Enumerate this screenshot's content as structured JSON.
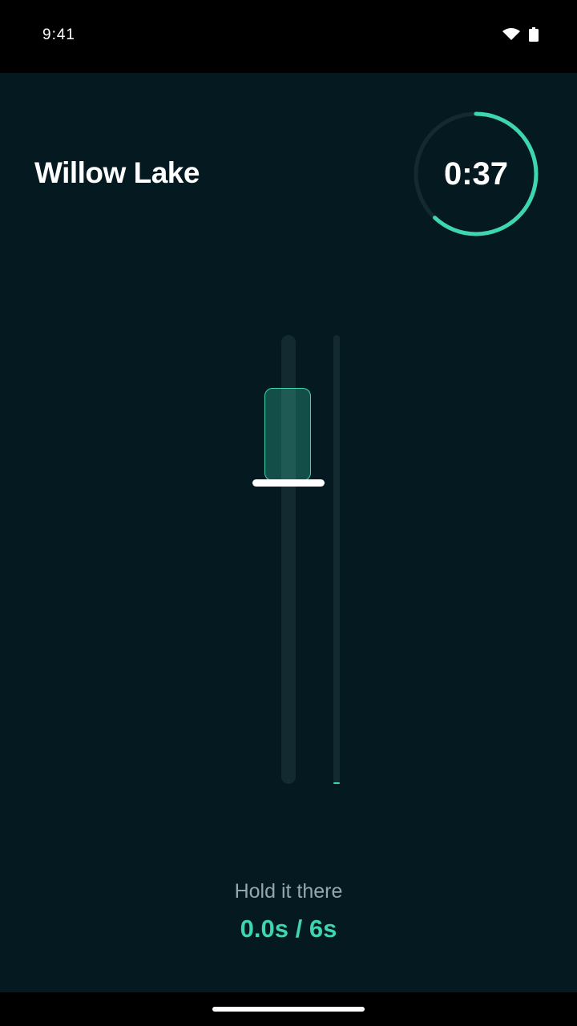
{
  "status_bar": {
    "time": "9:41",
    "icons": [
      "wifi-icon",
      "battery-icon"
    ]
  },
  "header": {
    "title": "Willow Lake",
    "timer_text": "0:37",
    "timer_progress": 0.62
  },
  "slider": {
    "hold_progress": 0.0
  },
  "footer": {
    "hint": "Hold it there",
    "hold_counter": "0.0s / 6s"
  },
  "colors": {
    "accent": "#3dd6b0",
    "background": "#051920",
    "track": "#142a31",
    "text_primary": "#ffffff",
    "text_secondary": "#93a7ad"
  }
}
